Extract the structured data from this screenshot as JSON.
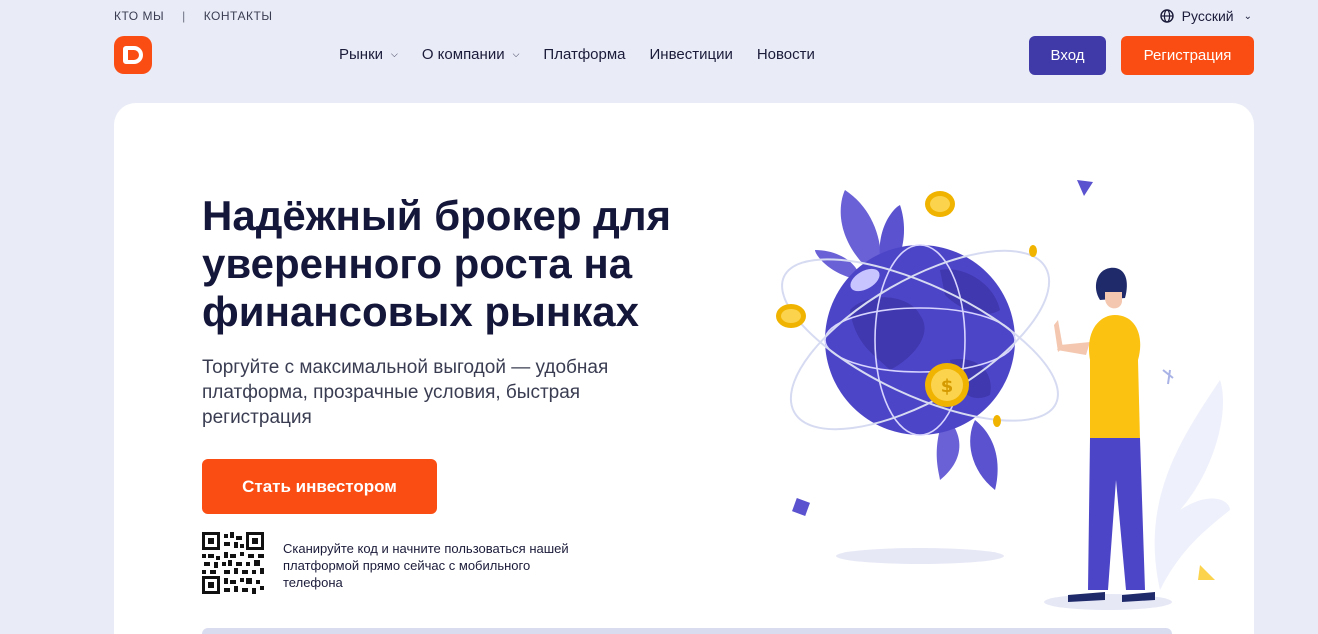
{
  "topbar": {
    "links": [
      "КТО МЫ",
      "КОНТАКТЫ"
    ],
    "separator": "|",
    "language": "Русский",
    "language_icon": "globe-icon"
  },
  "header": {
    "logo": "brand-logo",
    "nav": [
      {
        "label": "Рынки",
        "has_dropdown": true
      },
      {
        "label": "О компании",
        "has_dropdown": true
      },
      {
        "label": "Платформа",
        "has_dropdown": false
      },
      {
        "label": "Инвестиции",
        "has_dropdown": false
      },
      {
        "label": "Новости",
        "has_dropdown": false
      }
    ],
    "login_label": "Вход",
    "register_label": "Регистрация"
  },
  "hero": {
    "title": "Надёжный брокер для уверенного роста на финансовых рынках",
    "subtitle": "Торгуйте с максимальной выгодой — удобная платформа, прозрачные условия, быстрая регистрация",
    "cta_label": "Стать инвестором",
    "qr_text": "Сканируйте код и начните пользоваться нашей платформой прямо сейчас с мобильного телефона"
  },
  "colors": {
    "accent_orange": "#fa4d14",
    "accent_purple": "#3f3aa8",
    "background": "#e9ecf7",
    "globe": "#4d45c8"
  }
}
